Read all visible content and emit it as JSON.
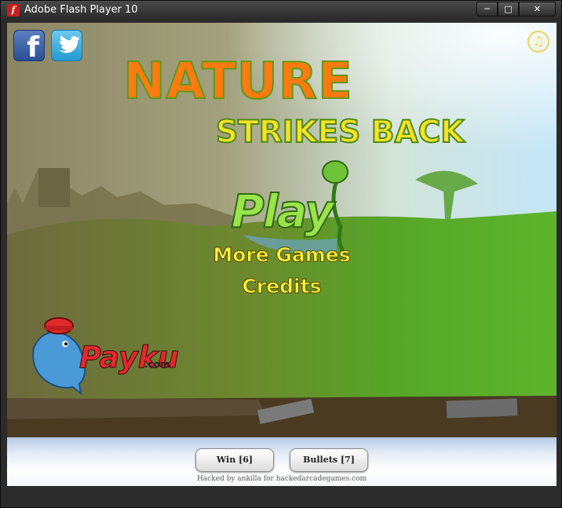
{
  "window": {
    "title": "Adobe Flash Player 10",
    "controls": {
      "minimize": "─",
      "maximize": "□",
      "close": "✕"
    }
  },
  "game": {
    "title_line1": "NATURE",
    "title_line2": "STRIKES BACK",
    "menu": {
      "play": "Play",
      "more_games": "More Games",
      "credits": "Credits"
    },
    "social": {
      "facebook_glyph": "f"
    },
    "music_glyph": "♫",
    "sponsor": {
      "name": "Payku",
      "suffix": ".com"
    }
  },
  "hack_bar": {
    "win_button": "Win [6]",
    "bullets_button": "Bullets [7]",
    "credit": "Hacked by ankilla for hackedarcadegames.com"
  },
  "colors": {
    "sky_left": "#8a8462",
    "sky_right": "#bfe0f2",
    "grass": "#5fae2a",
    "title_orange": "#ff7a10",
    "title_yellow": "#f6e227",
    "play_green": "#9be34b",
    "menu_yellow": "#fff23c"
  }
}
